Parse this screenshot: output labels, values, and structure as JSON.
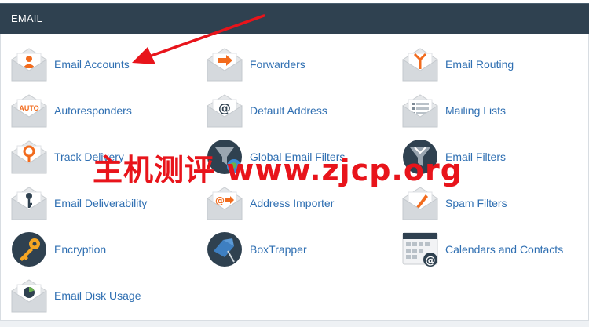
{
  "header": {
    "title": "EMAIL"
  },
  "items": [
    {
      "label": "Email Accounts",
      "icon": "envelope-person-icon"
    },
    {
      "label": "Forwarders",
      "icon": "envelope-arrow-icon"
    },
    {
      "label": "Email Routing",
      "icon": "envelope-route-icon"
    },
    {
      "label": "Autoresponders",
      "icon": "envelope-auto-icon"
    },
    {
      "label": "Default Address",
      "icon": "envelope-at-icon"
    },
    {
      "label": "Mailing Lists",
      "icon": "envelope-list-icon"
    },
    {
      "label": "Track Delivery",
      "icon": "envelope-pin-icon"
    },
    {
      "label": "Global Email Filters",
      "icon": "globe-filter-icon"
    },
    {
      "label": "Email Filters",
      "icon": "funnel-filter-icon"
    },
    {
      "label": "Email Deliverability",
      "icon": "envelope-key-icon"
    },
    {
      "label": "Address Importer",
      "icon": "envelope-import-icon"
    },
    {
      "label": "Spam Filters",
      "icon": "envelope-pen-icon"
    },
    {
      "label": "Encryption",
      "icon": "key-icon"
    },
    {
      "label": "BoxTrapper",
      "icon": "box-trap-icon"
    },
    {
      "label": "Calendars and Contacts",
      "icon": "calendar-at-icon"
    },
    {
      "label": "Email Disk Usage",
      "icon": "envelope-pie-icon"
    }
  ],
  "watermark": "主机测评 www.zjcp.org",
  "colors": {
    "header_bg": "#2f4150",
    "link": "#2f6fb2",
    "accent_orange": "#f26b1d",
    "watermark": "#e8141b"
  }
}
